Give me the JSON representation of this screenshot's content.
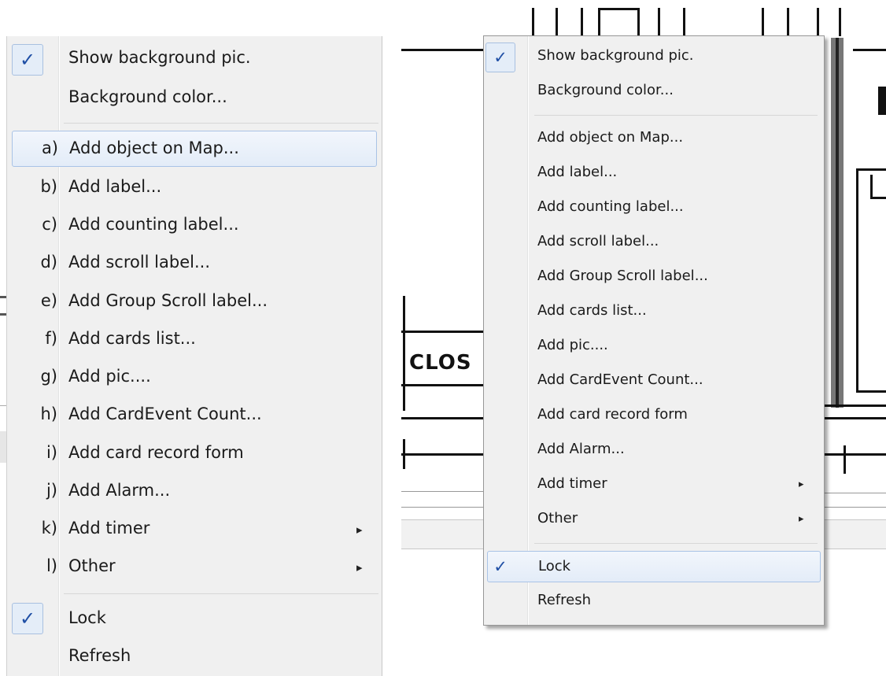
{
  "left_menu": {
    "show_background_pic": "Show background pic.",
    "background_color": "Background color...",
    "items": [
      {
        "letter": "a)",
        "label": "Add object on Map..."
      },
      {
        "letter": "b)",
        "label": "Add label..."
      },
      {
        "letter": "c)",
        "label": "Add counting label..."
      },
      {
        "letter": "d)",
        "label": "Add scroll label..."
      },
      {
        "letter": "e)",
        "label": "Add Group Scroll label..."
      },
      {
        "letter": "f)",
        "label": "Add cards list..."
      },
      {
        "letter": "g)",
        "label": "Add pic...."
      },
      {
        "letter": "h)",
        "label": "Add CardEvent Count..."
      },
      {
        "letter": "i)",
        "label": "Add card record form"
      },
      {
        "letter": "j)",
        "label": "Add Alarm..."
      },
      {
        "letter": "k)",
        "label": "Add timer"
      },
      {
        "letter": "l)",
        "label": "Other"
      }
    ],
    "lock": "Lock",
    "refresh": "Refresh",
    "check_glyph": "✓",
    "submenu_arrow": "▸"
  },
  "right_menu": {
    "show_background_pic": "Show background pic.",
    "background_color": "Background color...",
    "items": [
      "Add object on Map...",
      "Add label...",
      "Add counting label...",
      "Add scroll label...",
      "Add Group Scroll label...",
      "Add cards list...",
      "Add pic....",
      "Add CardEvent Count...",
      "Add card record form",
      "Add Alarm...",
      "Add timer",
      "Other"
    ],
    "lock": "Lock",
    "refresh": "Refresh",
    "check_glyph": "✓",
    "submenu_arrow": "▸"
  },
  "background": {
    "clos_text": "CLOS"
  },
  "colors": {
    "menu_bg": "#f0f0f0",
    "highlight_border": "#a9c3e6",
    "check_blue": "#1f4fa5"
  }
}
